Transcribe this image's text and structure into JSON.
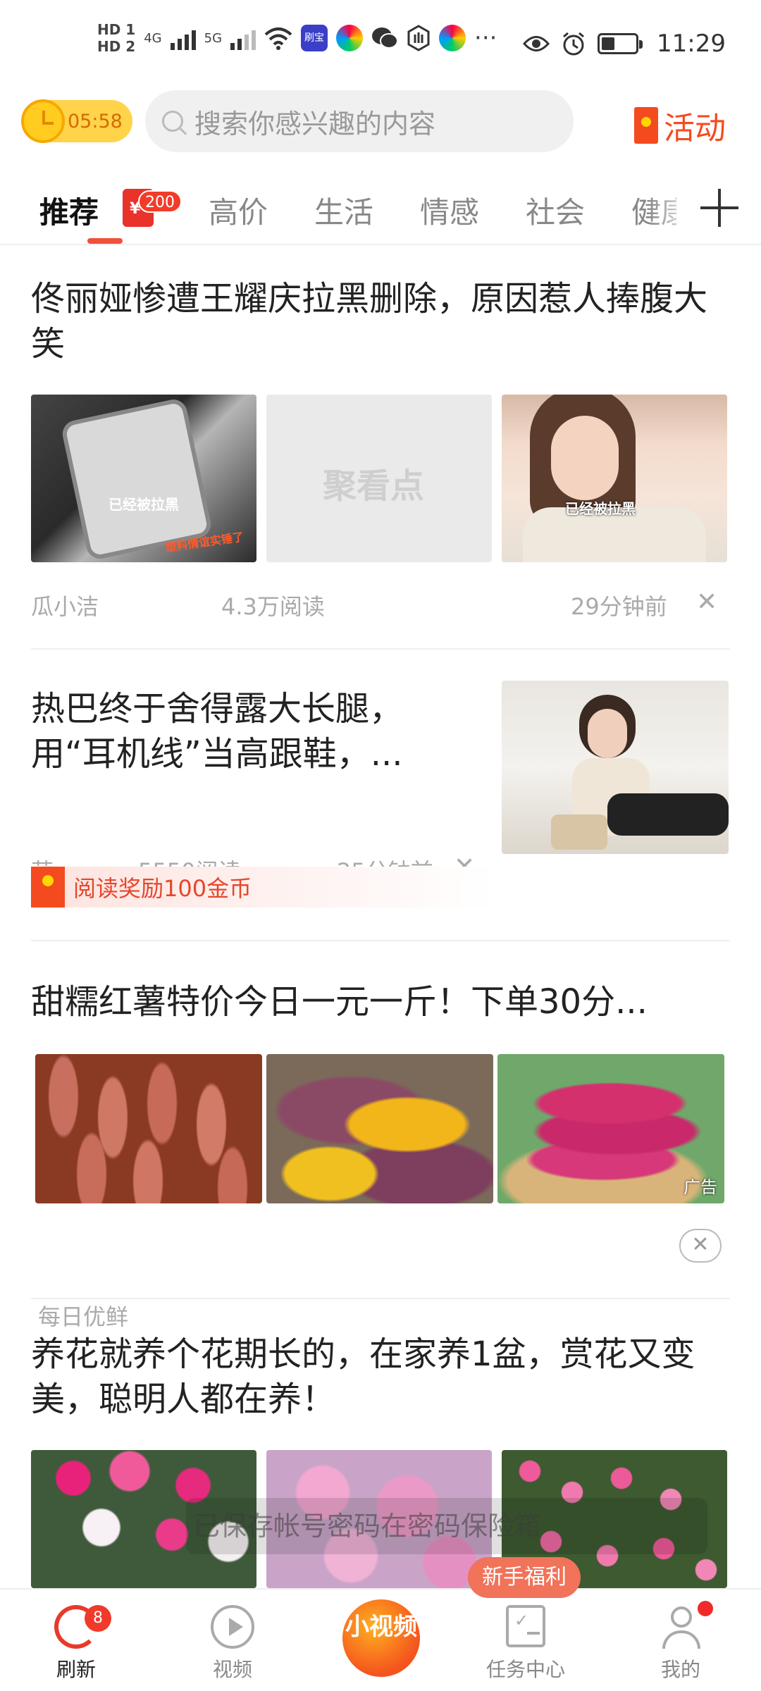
{
  "status_bar": {
    "hd1": "HD 1",
    "hd2": "HD 2",
    "net1": "4G",
    "net2": "5G",
    "app_label": "刷宝",
    "more": "···",
    "time": "11:29"
  },
  "header": {
    "timer": "05:58",
    "search_placeholder": "搜索你感兴趣的内容",
    "activity_label": "活动"
  },
  "tabs": {
    "items": [
      "推荐",
      "高价",
      "生活",
      "情感",
      "社会",
      "健康"
    ],
    "active_index": 0,
    "redpack_badge": "200"
  },
  "feed": {
    "item1": {
      "title": "佟丽娅惨遭王耀庆拉黑删除，原因惹人捧腹大笑",
      "img1_caption": "已经被拉黑",
      "img1_caption2": "塑料情谊实锤了",
      "img2_watermark": "聚看点",
      "img3_caption": "已经被拉黑",
      "author": "瓜小洁",
      "reads": "4.3万阅读",
      "time": "29分钟前",
      "close": "✕"
    },
    "item2": {
      "title": "热巴终于舍得露大长腿，用“耳机线”当高跟鞋，...",
      "author": "萌...",
      "reads": "5550阅读",
      "time": "25分钟前",
      "close": "✕",
      "reward": "阅读奖励100金币"
    },
    "item3": {
      "title": "甜糯红薯特价今日一元一斤！下单30分...",
      "ad_tag": "广告",
      "source": "每日优鲜",
      "close": "✕"
    },
    "item4": {
      "title": "养花就养个花期长的，在家养1盆，赏花又变美，聪明人都在养！"
    }
  },
  "toast": "已保存帐号密码在密码保险箱",
  "bottom_nav": {
    "refresh": "刷新",
    "refresh_badge": "8",
    "video": "视频",
    "small_video": "小视频",
    "tasks": "任务中心",
    "newbie_badge": "新手福利",
    "me": "我的"
  }
}
